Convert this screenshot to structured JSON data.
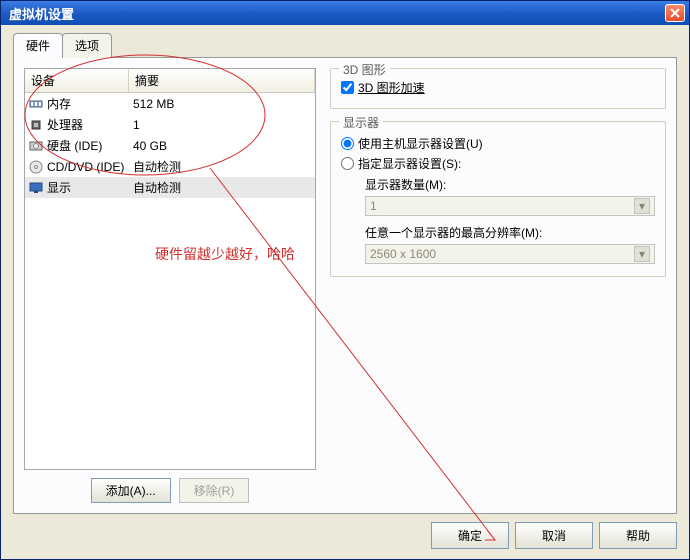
{
  "window": {
    "title": "虚拟机设置"
  },
  "tabs": {
    "hardware": "硬件",
    "options": "选项"
  },
  "device_table": {
    "headers": {
      "device": "设备",
      "summary": "摘要"
    },
    "rows": [
      {
        "icon": "memory-icon",
        "device": "内存",
        "summary": "512 MB"
      },
      {
        "icon": "cpu-icon",
        "device": "处理器",
        "summary": "1"
      },
      {
        "icon": "disk-icon",
        "device": "硬盘 (IDE)",
        "summary": "40 GB"
      },
      {
        "icon": "cd-icon",
        "device": "CD/DVD (IDE)",
        "summary": "自动检测"
      },
      {
        "icon": "display-icon",
        "device": "显示",
        "summary": "自动检测",
        "selected": true
      }
    ]
  },
  "left_buttons": {
    "add": "添加(A)...",
    "remove": "移除(R)"
  },
  "section_3d": {
    "title": "3D 图形",
    "checkbox_label": "3D 图形加速"
  },
  "section_displays": {
    "title": "显示器",
    "radio_use_host": "使用主机显示器设置(U)",
    "radio_specify": "指定显示器设置(S):",
    "count_label": "显示器数量(M):",
    "count_value": "1",
    "maxres_label": "任意一个显示器的最高分辨率(M):",
    "maxres_value": "2560 x 1600"
  },
  "bottom": {
    "ok": "确定",
    "cancel": "取消",
    "help": "帮助"
  },
  "annotation": {
    "text": "硬件留越少越好，哈哈"
  }
}
